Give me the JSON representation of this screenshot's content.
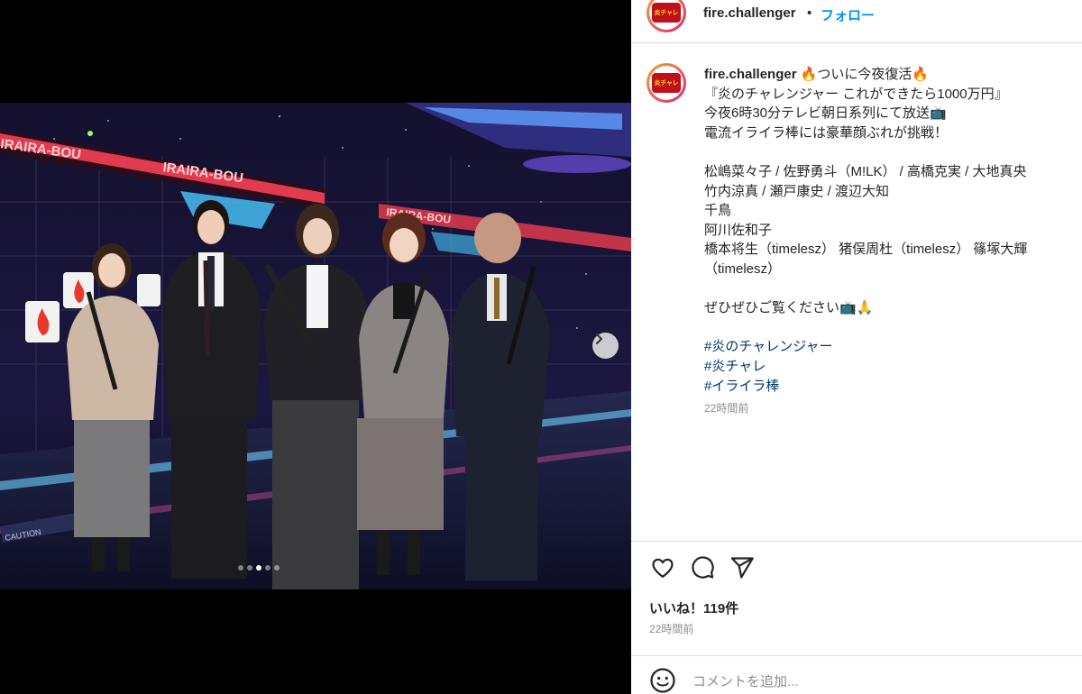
{
  "header": {
    "avatar_logo": "炎チャレ",
    "username": "fire.challenger",
    "separator": "•",
    "follow_label": "フォロー"
  },
  "photo": {
    "banner_text": "IRAIRA-BOU",
    "caution_text": "CAUTION",
    "carousel_total": 5,
    "carousel_active": 3
  },
  "caption": {
    "username": "fire.challenger",
    "lines": [
      "🔥ついに今夜復活🔥",
      "『炎のチャレンジャー これができたら1000万円』",
      "今夜6時30分テレビ朝日系列にて放送📺",
      "電流イライラ棒には豪華顔ぶれが挑戦！",
      "",
      "松嶋菜々子 / 佐野勇斗（M!LK） / 高橋克実 / 大地真央",
      "竹内涼真 / 瀬戸康史 / 渡辺大知",
      "千鳥",
      "阿川佐和子",
      "橋本将生（timelesz） 猪俣周杜（timelesz） 篠塚大輝",
      "（timelesz）",
      "",
      "ぜひぜひご覧ください📺🙏"
    ],
    "hashtags": [
      "#炎のチャレンジャー",
      "#炎チャレ",
      "#イライラ棒"
    ],
    "time": "22時間前"
  },
  "actions": {
    "like_icon": "heart-icon",
    "comment_icon": "comment-icon",
    "share_icon": "share-icon"
  },
  "stats": {
    "likes": "いいね！119件",
    "posted_ago": "22時間前"
  },
  "comment": {
    "placeholder": "コメントを追加..."
  },
  "colors": {
    "accent": "#0095f6",
    "hashtag": "#00376b",
    "muted": "#8e8e8e",
    "text": "#262626",
    "divider": "#dbdbdb"
  }
}
